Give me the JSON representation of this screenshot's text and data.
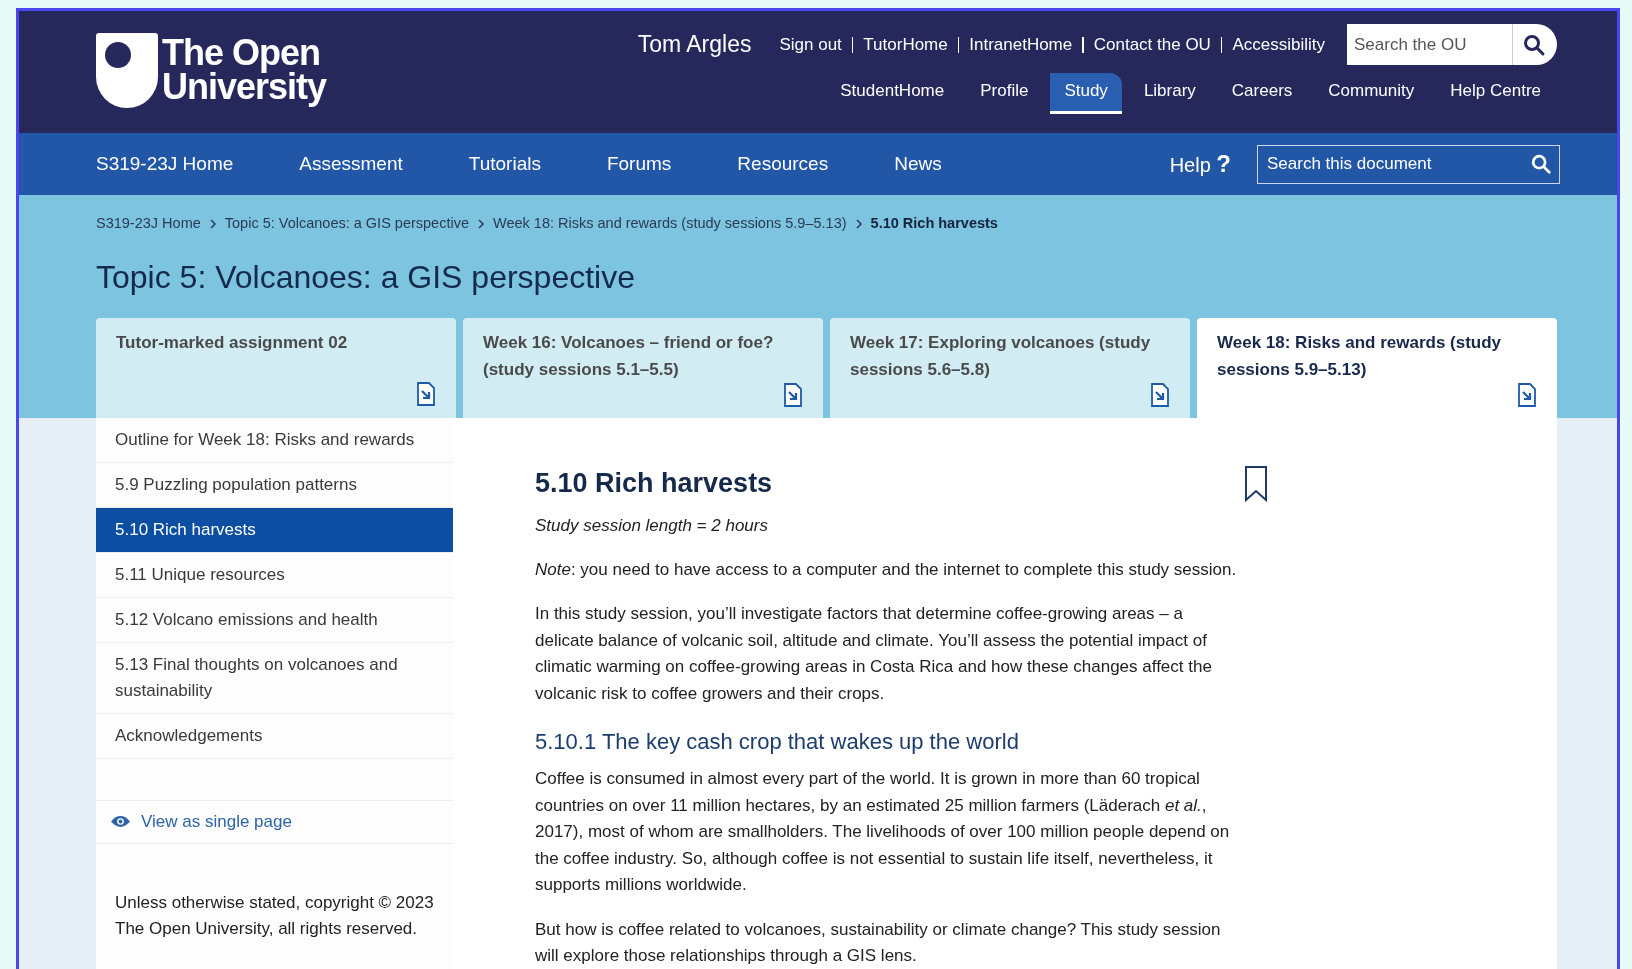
{
  "header": {
    "logo": {
      "lines": [
        "The Open",
        "University"
      ]
    },
    "user_name": "Tom Argles",
    "top_links": [
      "Sign out",
      "TutorHome",
      "IntranetHome",
      "Contact the OU",
      "Accessibility"
    ],
    "search": {
      "placeholder": "Search the OU"
    },
    "main_nav": [
      {
        "label": "StudentHome",
        "selected": false
      },
      {
        "label": "Profile",
        "selected": false
      },
      {
        "label": "Study",
        "selected": true
      },
      {
        "label": "Library",
        "selected": false
      },
      {
        "label": "Careers",
        "selected": false
      },
      {
        "label": "Community",
        "selected": false
      },
      {
        "label": "Help Centre",
        "selected": false
      }
    ]
  },
  "course_nav": {
    "items": [
      "S319-23J Home",
      "Assessment",
      "Tutorials",
      "Forums",
      "Resources",
      "News"
    ],
    "help": {
      "label": "Help",
      "glyph": "?"
    },
    "search": {
      "placeholder": "Search this document"
    }
  },
  "breadcrumb": [
    {
      "label": "S319-23J Home",
      "current": false
    },
    {
      "label": "Topic 5: Volcanoes: a GIS perspective",
      "current": false
    },
    {
      "label": "Week 18: Risks and rewards (study sessions 5.9–5.13)",
      "current": false
    },
    {
      "label": "5.10 Rich harvests",
      "current": true
    }
  ],
  "title": "Topic 5: Volcanoes: a GIS perspective",
  "tabs": [
    {
      "label": "Tutor-marked assignment 02",
      "selected": false
    },
    {
      "label": "Week 16: Volcanoes – friend or foe? (study sessions 5.1–5.5)",
      "selected": false
    },
    {
      "label": "Week 17: Exploring volcanoes (study sessions 5.6–5.8)",
      "selected": false
    },
    {
      "label": "Week 18: Risks and rewards (study sessions 5.9–5.13)",
      "selected": true
    }
  ],
  "sidebar": {
    "items": [
      {
        "label": "Outline for Week 18: Risks and rewards",
        "selected": false
      },
      {
        "label": "5.9 Puzzling population patterns",
        "selected": false
      },
      {
        "label": "5.10 Rich harvests",
        "selected": true
      },
      {
        "label": "5.11 Unique resources",
        "selected": false
      },
      {
        "label": "5.12 Volcano emissions and health",
        "selected": false
      },
      {
        "label": "5.13 Final thoughts on volcanoes and sustainability",
        "selected": false
      },
      {
        "label": "Acknowledgements",
        "selected": false
      }
    ],
    "single_page_link": "View as single page",
    "copyright": "Unless otherwise stated, copyright © 2023 The Open University, all rights reserved."
  },
  "article": {
    "heading": "5.10 Rich harvests",
    "session_length": "Study session length = 2 hours",
    "blocks": [
      {
        "kind": "paragraph",
        "text": "*Note*: you need to have access to a computer and the internet to complete this study session."
      },
      {
        "kind": "paragraph",
        "text": "In this study session, you’ll investigate factors that determine coffee-growing areas – a delicate balance of volcanic soil, altitude and climate. You’ll assess the potential impact of climatic warming on coffee-growing areas in Costa Rica and how these changes affect the volcanic risk to coffee growers and their crops."
      },
      {
        "kind": "subheading",
        "text": "5.10.1 The key cash crop that wakes up the world"
      },
      {
        "kind": "paragraph",
        "text": "Coffee is consumed in almost every part of the world. It is grown in more than 60 tropical countries on over 11 million hectares, by an estimated 25 million farmers (Läderach *et al.*, 2017), most of whom are smallholders. The livelihoods of over 100 million people depend on the coffee industry. So, although coffee is not essential to sustain life itself, nevertheless, it supports millions worldwide."
      },
      {
        "kind": "paragraph",
        "text": "But how is coffee related to volcanoes, sustainability or climate change? This study session will explore those relationships through a GIS lens."
      }
    ]
  }
}
